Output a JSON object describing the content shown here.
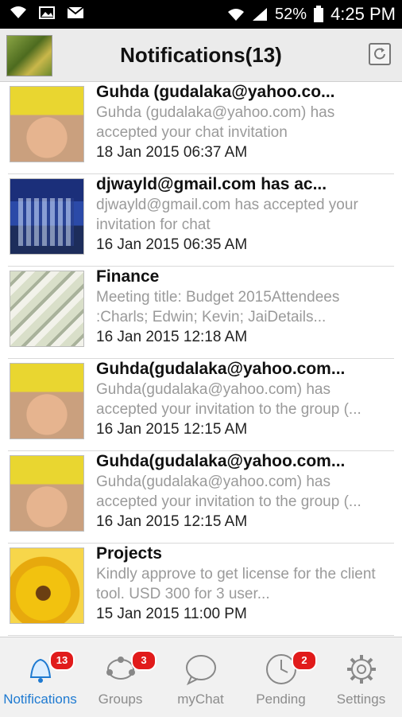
{
  "status_bar": {
    "battery": "52%",
    "time": "4:25 PM"
  },
  "app_bar": {
    "title": "Notifications(13)"
  },
  "notifications": [
    {
      "name": "Guhda (gudalaka@yahoo.co...",
      "message": "Guhda (gudalaka@yahoo.com) has accepted your chat invitation",
      "time": "18 Jan 2015 06:37 AM",
      "avatar": "baby-photo"
    },
    {
      "name": "djwayld@gmail.com has ac...",
      "message": "djwayld@gmail.com has accepted your invitation for chat",
      "time": "16 Jan 2015 06:35 AM",
      "avatar": "city-photo"
    },
    {
      "name": "Finance",
      "message": "Meeting title: Budget 2015Attendees :Charls; Edwin; Kevin; JaiDetails...",
      "time": "16 Jan 2015 12:18 AM",
      "avatar": "money-photo"
    },
    {
      "name": "Guhda(gudalaka@yahoo.com...",
      "message": "Guhda(gudalaka@yahoo.com) has accepted your invitation to the group (...",
      "time": "16 Jan 2015 12:15 AM",
      "avatar": "baby-photo"
    },
    {
      "name": "Guhda(gudalaka@yahoo.com...",
      "message": "Guhda(gudalaka@yahoo.com) has accepted your invitation to the group (...",
      "time": "16 Jan 2015 12:15 AM",
      "avatar": "baby-photo"
    },
    {
      "name": "Projects",
      "message": "Kindly approve to get license for the client tool. USD 300 for 3 user...",
      "time": "15 Jan 2015 11:00 PM",
      "avatar": "sunflower-photo"
    }
  ],
  "tabs": [
    {
      "label": "Notifications",
      "badge": "13",
      "icon": "bell-icon",
      "active": true
    },
    {
      "label": "Groups",
      "badge": "3",
      "icon": "groups-icon",
      "active": false
    },
    {
      "label": "myChat",
      "badge": "",
      "icon": "chat-bubble-icon",
      "active": false
    },
    {
      "label": "Pending",
      "badge": "2",
      "icon": "clock-icon",
      "active": false
    },
    {
      "label": "Settings",
      "badge": "",
      "icon": "gear-icon",
      "active": false
    }
  ],
  "colors": {
    "accent": "#1e7ad1",
    "badge": "#e11b1b",
    "appbar": "#ebebeb"
  }
}
